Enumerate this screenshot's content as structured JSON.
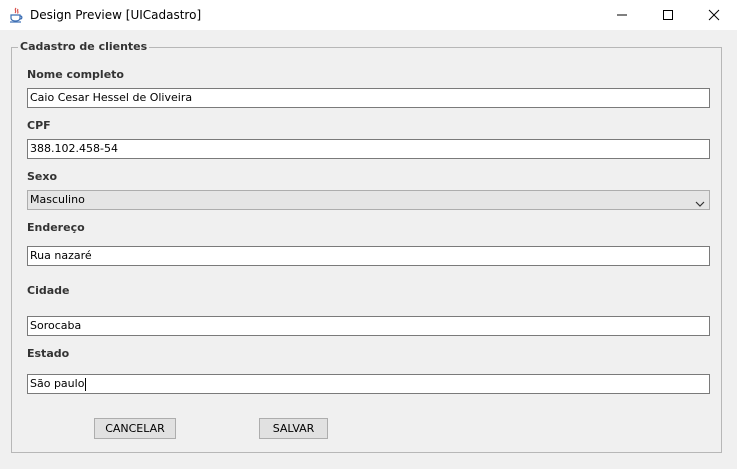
{
  "window": {
    "title": "Design Preview [UICadastro]"
  },
  "form": {
    "group_title": "Cadastro de clientes",
    "fields": {
      "nome": {
        "label": "Nome completo",
        "value": "Caio Cesar Hessel de Oliveira"
      },
      "cpf": {
        "label": "CPF",
        "value": "388.102.458-54"
      },
      "sexo": {
        "label": "Sexo",
        "value": "Masculino"
      },
      "endereco": {
        "label": "Endereço",
        "value": "Rua nazaré"
      },
      "cidade": {
        "label": "Cidade",
        "value": "Sorocaba"
      },
      "estado": {
        "label": "Estado",
        "value": "São paulo"
      }
    },
    "buttons": {
      "cancel_label": "CANCELAR",
      "save_label": "SALVAR"
    }
  },
  "icons": {
    "app": "java-cup-icon",
    "minimize": "minimize-icon",
    "maximize": "maximize-icon",
    "close": "close-icon",
    "dropdown": "chevron-down-icon"
  }
}
